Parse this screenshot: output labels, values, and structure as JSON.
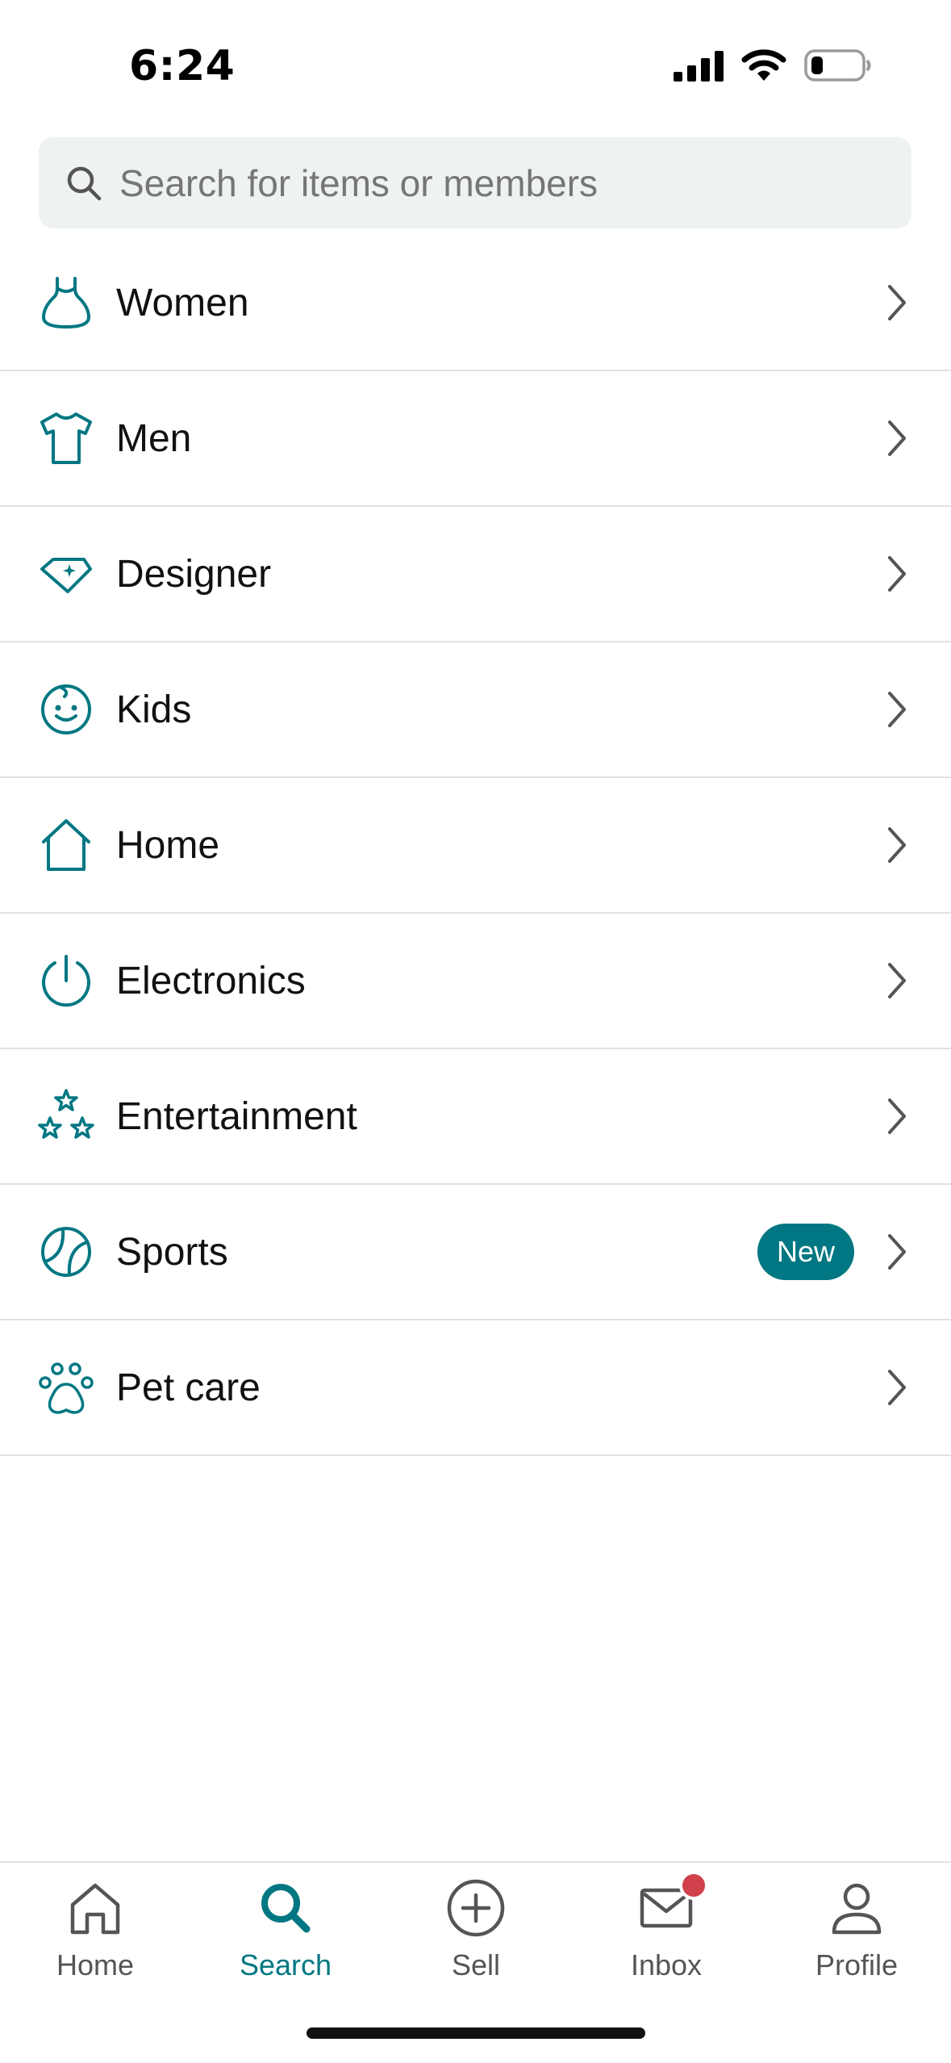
{
  "status_bar": {
    "time": "6:24"
  },
  "search": {
    "placeholder": "Search for items or members"
  },
  "categories": [
    {
      "label": "Women",
      "icon": "dress-icon"
    },
    {
      "label": "Men",
      "icon": "tshirt-icon"
    },
    {
      "label": "Designer",
      "icon": "diamond-icon"
    },
    {
      "label": "Kids",
      "icon": "smiley-face-icon"
    },
    {
      "label": "Home",
      "icon": "house-icon"
    },
    {
      "label": "Electronics",
      "icon": "power-icon"
    },
    {
      "label": "Entertainment",
      "icon": "stars-icon"
    },
    {
      "label": "Sports",
      "icon": "tennis-ball-icon",
      "badge": "New"
    },
    {
      "label": "Pet care",
      "icon": "paw-icon"
    }
  ],
  "tabs": [
    {
      "label": "Home",
      "icon": "home-icon"
    },
    {
      "label": "Search",
      "icon": "search-icon",
      "active": true
    },
    {
      "label": "Sell",
      "icon": "plus-circle-icon"
    },
    {
      "label": "Inbox",
      "icon": "mail-icon",
      "has_notification": true
    },
    {
      "label": "Profile",
      "icon": "person-icon"
    }
  ],
  "colors": {
    "accent": "#007782",
    "notification": "#d1414b",
    "search_bg": "#eff2f2",
    "divider": "#dfe2e2"
  }
}
